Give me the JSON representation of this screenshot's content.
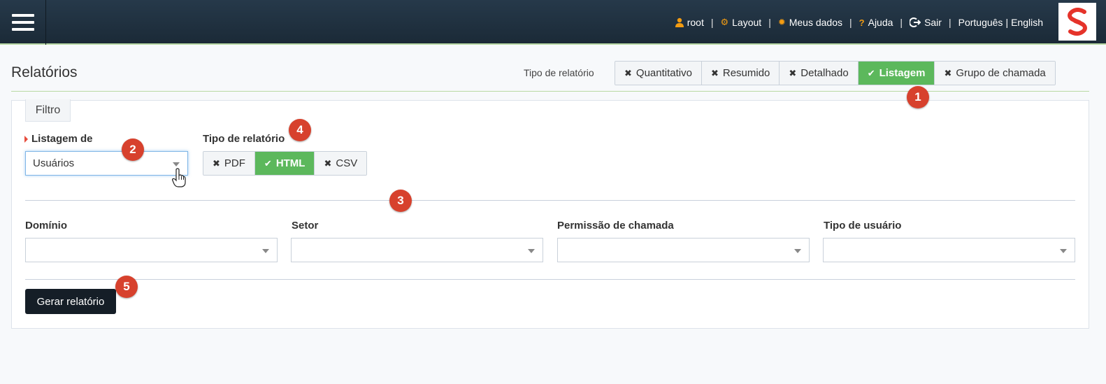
{
  "topnav": {
    "user": "root",
    "layout": "Layout",
    "my_data": "Meus dados",
    "help": "Ajuda",
    "logout": "Sair",
    "lang_pt": "Português",
    "lang_en": "English",
    "separator": "|"
  },
  "header": {
    "title": "Relatórios",
    "report_type_label": "Tipo de relatório",
    "report_types": [
      {
        "label": "Quantitativo",
        "active": false
      },
      {
        "label": "Resumido",
        "active": false
      },
      {
        "label": "Detalhado",
        "active": false
      },
      {
        "label": "Listagem",
        "active": true
      },
      {
        "label": "Grupo de chamada",
        "active": false
      }
    ]
  },
  "filter": {
    "tab_label": "Filtro",
    "listing_label": "Listagem de",
    "listing_value": "Usuários",
    "format_label": "Tipo de relatório",
    "formats": [
      {
        "label": "PDF",
        "active": false
      },
      {
        "label": "HTML",
        "active": true
      },
      {
        "label": "CSV",
        "active": false
      }
    ],
    "fields": [
      {
        "label": "Domínio",
        "value": ""
      },
      {
        "label": "Setor",
        "value": ""
      },
      {
        "label": "Permissão de chamada",
        "value": ""
      },
      {
        "label": "Tipo de usuário",
        "value": ""
      }
    ],
    "submit_label": "Gerar relatório"
  },
  "badges": [
    "1",
    "2",
    "3",
    "4",
    "5"
  ],
  "colors": {
    "topbar": "#1f303e",
    "active_green": "#5cb85c",
    "badge_red": "#d7412d",
    "icon_orange": "#f39c12"
  }
}
